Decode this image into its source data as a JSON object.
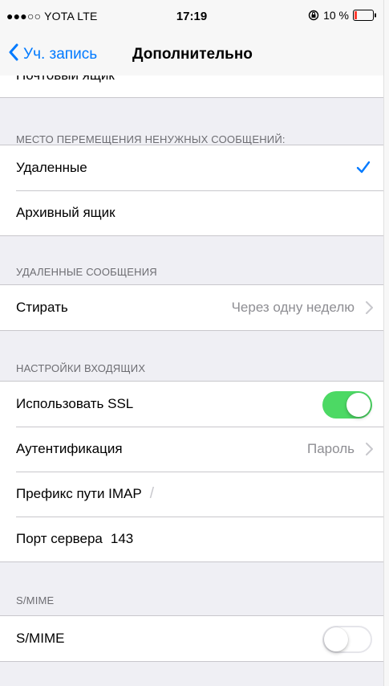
{
  "status_bar": {
    "carrier": "●●●○○ YOTA  LTE",
    "time": "17:19",
    "battery": "10 %"
  },
  "nav": {
    "back_label": "Уч. запись",
    "title": "Дополнительно"
  },
  "clipped_row_label": "Почтовый ящик",
  "sections": {
    "move_header": "МЕСТО ПЕРЕМЕЩЕНИЯ НЕНУЖНЫХ СООБЩЕНИЙ:",
    "move_options": [
      "Удаленные",
      "Архивный ящик"
    ],
    "move_selected": "Удаленные",
    "deleted_header": "УДАЛЕННЫЕ СООБЩЕНИЯ",
    "erase_label": "Стирать",
    "erase_value": "Через одну неделю",
    "incoming_header": "НАСТРОЙКИ ВХОДЯЩИХ",
    "ssl_label": "Использовать SSL",
    "ssl_enabled": true,
    "auth_label": "Аутентификация",
    "auth_value": "Пароль",
    "imap_prefix_label": "Префикс пути IMAP",
    "imap_prefix_value": "/",
    "port_label": "Порт сервера",
    "port_value": "143",
    "smime_header": "S/MIME",
    "smime_label": "S/MIME",
    "smime_enabled": false
  },
  "colors": {
    "accent": "#007aff",
    "toggle_on": "#4cd964",
    "background": "#efeff4",
    "separator": "#c8c7cc"
  },
  "icons": [
    "back-chevron-icon",
    "lock-rotation-icon",
    "battery-icon",
    "checkmark-icon",
    "chevron-right-icon"
  ]
}
